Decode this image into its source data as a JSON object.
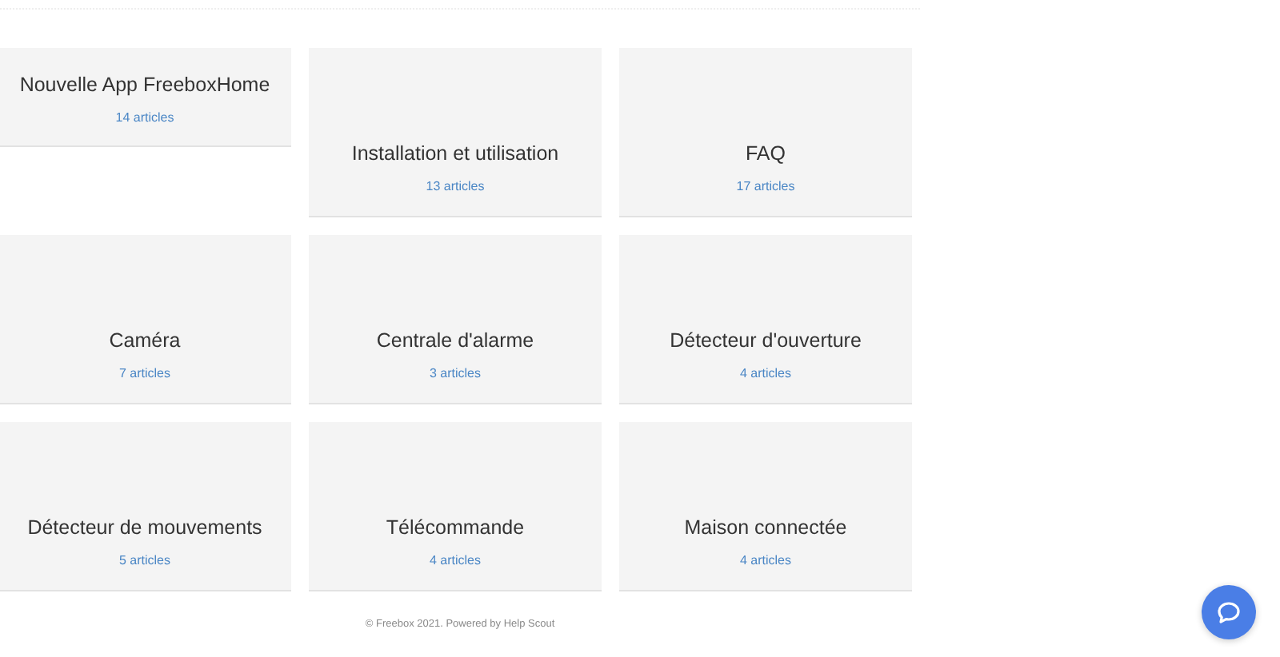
{
  "categories": [
    {
      "title": "Nouvelle App FreeboxHome",
      "count": "14 articles",
      "kind": "short"
    },
    {
      "title": "Installation et utilisation",
      "count": "13 articles",
      "kind": "tall"
    },
    {
      "title": "FAQ",
      "count": "17 articles",
      "kind": "tall"
    },
    {
      "title": "Caméra",
      "count": "7 articles",
      "kind": "tall"
    },
    {
      "title": "Centrale d'alarme",
      "count": "3 articles",
      "kind": "tall"
    },
    {
      "title": "Détecteur d'ouverture",
      "count": "4 articles",
      "kind": "tall"
    },
    {
      "title": "Détecteur de mouvements",
      "count": "5 articles",
      "kind": "tall"
    },
    {
      "title": "Télécommande",
      "count": "4 articles",
      "kind": "tall"
    },
    {
      "title": "Maison connectée",
      "count": "4 articles",
      "kind": "tall"
    }
  ],
  "footer": "© Freebox 2021. Powered by Help Scout"
}
